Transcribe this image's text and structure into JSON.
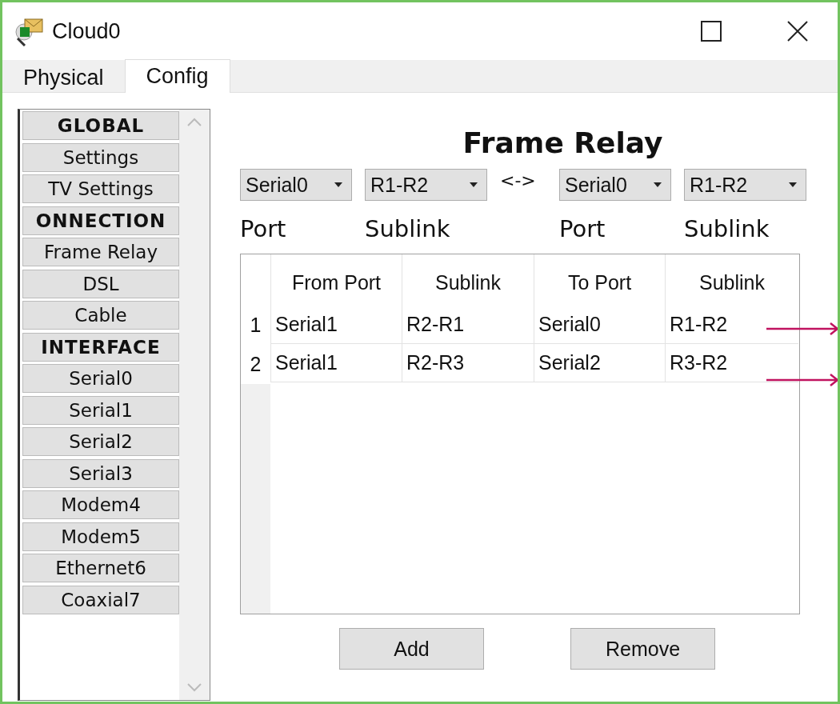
{
  "window": {
    "title": "Cloud0"
  },
  "tabs": [
    {
      "label": "Physical",
      "selected": false
    },
    {
      "label": "Config",
      "selected": true
    }
  ],
  "sidebar": {
    "items": [
      {
        "label": "GLOBAL",
        "kind": "header"
      },
      {
        "label": "Settings",
        "kind": "item"
      },
      {
        "label": "TV Settings",
        "kind": "item"
      },
      {
        "label": "ONNECTION",
        "kind": "header"
      },
      {
        "label": "Frame Relay",
        "kind": "item"
      },
      {
        "label": "DSL",
        "kind": "item"
      },
      {
        "label": "Cable",
        "kind": "item"
      },
      {
        "label": "INTERFACE",
        "kind": "header"
      },
      {
        "label": "Serial0",
        "kind": "item"
      },
      {
        "label": "Serial1",
        "kind": "item"
      },
      {
        "label": "Serial2",
        "kind": "item"
      },
      {
        "label": "Serial3",
        "kind": "item"
      },
      {
        "label": "Modem4",
        "kind": "item"
      },
      {
        "label": "Modem5",
        "kind": "item"
      },
      {
        "label": "Ethernet6",
        "kind": "item"
      },
      {
        "label": "Coaxial7",
        "kind": "item"
      }
    ]
  },
  "panel": {
    "title": "Frame Relay",
    "selectors": [
      {
        "value": "Serial0",
        "label": "Port"
      },
      {
        "value": "R1-R2",
        "label": "Sublink"
      },
      {
        "value": "Serial0",
        "label": "Port"
      },
      {
        "value": "R1-R2",
        "label": "Sublink"
      }
    ],
    "link_symbol": "<->",
    "table": {
      "columns": [
        "From Port",
        "Sublink",
        "To Port",
        "Sublink"
      ],
      "rows": [
        {
          "number": "1",
          "cells": [
            "Serial1",
            "R2-R1",
            "Serial0",
            "R1-R2"
          ]
        },
        {
          "number": "2",
          "cells": [
            "Serial1",
            "R2-R3",
            "Serial2",
            "R3-R2"
          ]
        }
      ]
    },
    "buttons": [
      "Add",
      "Remove"
    ]
  }
}
